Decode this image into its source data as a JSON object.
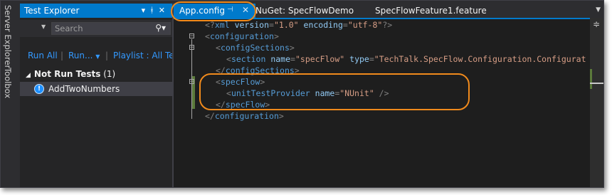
{
  "side_tabs": {
    "server_explorer": "Server Explorer",
    "toolbox": "Toolbox"
  },
  "test_explorer": {
    "title": "Test Explorer",
    "header_icons": "▾ ᚼ ✕",
    "search_placeholder": "Search",
    "toolbar": {
      "run_all": "Run All",
      "run": "Run...",
      "playlist": "Playlist : All Tests"
    },
    "group": {
      "name": "Not Run Tests",
      "count": "(1)"
    },
    "tests": [
      {
        "name": "AddTwoNumbers",
        "status": "not-run"
      }
    ]
  },
  "tabs": [
    {
      "label": "App.config",
      "active": true
    },
    {
      "label": "NuGet: SpecFlowDemo",
      "active": false
    },
    {
      "label": "SpecFlowFeature1.feature",
      "active": false
    }
  ],
  "editor": {
    "lines": [
      {
        "pre": "<?",
        "tag": "xml",
        "attrs": [
          {
            "n": "version",
            "v": "\"1.0\""
          },
          {
            "n": "encoding",
            "v": "\"utf-8\""
          }
        ],
        "post": "?>"
      },
      {
        "pre": "<",
        "tag": "configuration",
        "post": ">"
      },
      {
        "pre": "<",
        "tag": "configSections",
        "post": ">"
      },
      {
        "pre": "<",
        "tag": "section",
        "attrs": [
          {
            "n": "name",
            "v": "\"specFlow\""
          },
          {
            "n": "type",
            "v": "\"TechTalk.SpecFlow.Configuration.Configurat"
          }
        ],
        "post": ""
      },
      {
        "pre": "</",
        "tag": "configSections",
        "post": ">"
      },
      {
        "pre": "<",
        "tag": "specFlow",
        "post": ">"
      },
      {
        "pre": "<",
        "tag": "unitTestProvider",
        "attrs": [
          {
            "n": "name",
            "v": "\"NUnit\""
          }
        ],
        "post": " />"
      },
      {
        "pre": "</",
        "tag": "specFlow",
        "post": ">"
      },
      {
        "pre": "</",
        "tag": "configuration",
        "post": ">"
      }
    ]
  },
  "colors": {
    "accent": "#007acc",
    "callout": "#f08a1c",
    "changed_margin": "#5b7a3b"
  }
}
